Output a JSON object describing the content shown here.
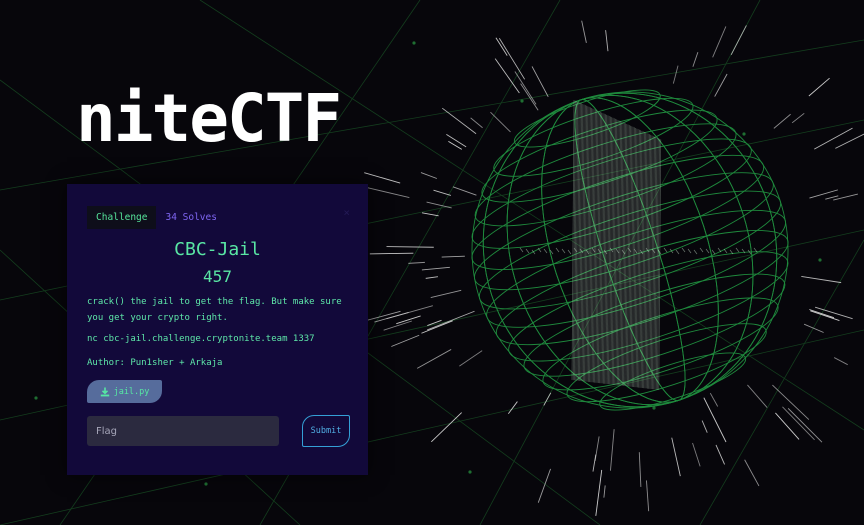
{
  "brand": {
    "title": "niteCTF"
  },
  "challenge": {
    "tabs": {
      "challenge_label": "Challenge",
      "solves_label": "34 Solves"
    },
    "close_label": "×",
    "name": "CBC-Jail",
    "points": "457",
    "description": "crack() the jail to get the flag. But make sure you get your crypto right.",
    "connection": "nc cbc-jail.challenge.cryptonite.team 1337",
    "author": "Author: Pun1sher + Arkaja",
    "file": {
      "label": "jail.py",
      "icon": "download-icon"
    },
    "flag_input": {
      "placeholder": "Flag",
      "value": ""
    },
    "submit_label": "Submit"
  },
  "colors": {
    "background": "#07060b",
    "card": "#12093a",
    "accent_green": "#5ee7a9",
    "solves_purple": "#7f66f2",
    "submit_blue": "#34a0d6",
    "globe_green": "#1f8a3d"
  }
}
